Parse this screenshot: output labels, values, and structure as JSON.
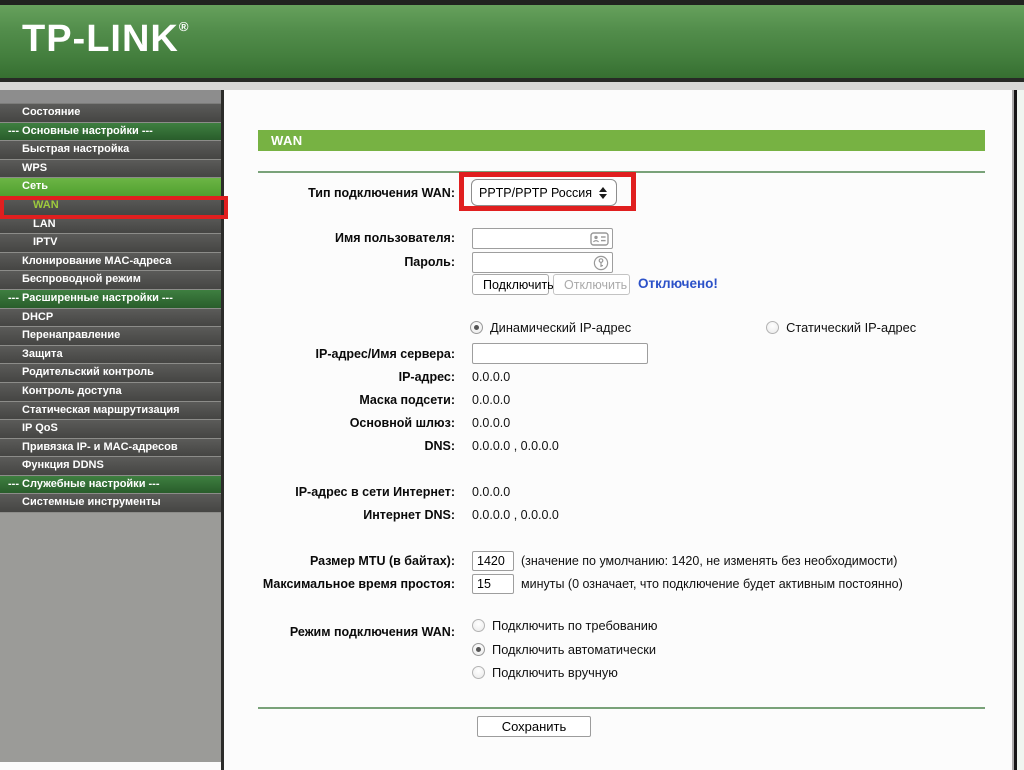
{
  "brand": {
    "name": "TP-LINK",
    "registered": "®"
  },
  "colors": {
    "header_green": "#4e8a49",
    "section_green": "#2f6b31",
    "active_green": "#5ca63b",
    "wan_bar_green": "#77b243",
    "highlight_red": "#e01f1f",
    "status_blue": "#2b51c8",
    "current_item_text": "#9dc93d"
  },
  "sidebar": {
    "items": [
      {
        "label": "Состояние",
        "type": "item"
      },
      {
        "label": "--- Основные настройки ---",
        "type": "section"
      },
      {
        "label": "Быстрая настройка",
        "type": "item"
      },
      {
        "label": "WPS",
        "type": "item"
      },
      {
        "label": "Сеть",
        "type": "active"
      },
      {
        "label": "WAN",
        "type": "sub current"
      },
      {
        "label": "LAN",
        "type": "sub"
      },
      {
        "label": "IPTV",
        "type": "sub"
      },
      {
        "label": "Клонирование MAC-адреса",
        "type": "item"
      },
      {
        "label": "Беспроводной режим",
        "type": "item"
      },
      {
        "label": "--- Расширенные настройки ---",
        "type": "section"
      },
      {
        "label": "DHCP",
        "type": "item"
      },
      {
        "label": "Перенаправление",
        "type": "item"
      },
      {
        "label": "Защита",
        "type": "item"
      },
      {
        "label": "Родительский контроль",
        "type": "item"
      },
      {
        "label": "Контроль доступа",
        "type": "item"
      },
      {
        "label": "Статическая маршрутизация",
        "type": "item"
      },
      {
        "label": "IP QoS",
        "type": "item"
      },
      {
        "label": "Привязка IP- и MAC-адресов",
        "type": "item"
      },
      {
        "label": "Функция DDNS",
        "type": "item"
      },
      {
        "label": "--- Служебные настройки ---",
        "type": "section"
      },
      {
        "label": "Системные инструменты",
        "type": "item"
      }
    ]
  },
  "main": {
    "title": "WAN",
    "connection_type": {
      "label": "Тип подключения WAN:",
      "value": "PPTP/PPTP Россия"
    },
    "username": {
      "label": "Имя пользователя:",
      "value": ""
    },
    "password": {
      "label": "Пароль:",
      "value": ""
    },
    "connect_button": "Подключить",
    "disconnect_button": "Отключить",
    "status_text": "Отключено!",
    "ip_mode": {
      "options": [
        {
          "label": "Динамический IP-адрес",
          "selected": true
        },
        {
          "label": "Статический IP-адрес",
          "selected": false
        }
      ]
    },
    "server": {
      "label": "IP-адрес/Имя сервера:",
      "value": ""
    },
    "ip": {
      "label": "IP-адрес:",
      "value": "0.0.0.0"
    },
    "mask": {
      "label": "Маска подсети:",
      "value": "0.0.0.0"
    },
    "gateway": {
      "label": "Основной шлюз:",
      "value": "0.0.0.0"
    },
    "dns": {
      "label": "DNS:",
      "value": "0.0.0.0 , 0.0.0.0"
    },
    "inet_ip": {
      "label": "IP-адрес в сети Интернет:",
      "value": "0.0.0.0"
    },
    "inet_dns": {
      "label": "Интернет DNS:",
      "value": "0.0.0.0 , 0.0.0.0"
    },
    "mtu": {
      "label": "Размер MTU (в байтах):",
      "value": "1420",
      "note": "(значение по умолчанию: 1420, не изменять без необходимости)"
    },
    "idle": {
      "label": "Максимальное время простоя:",
      "value": "15",
      "note": "минуты (0 означает, что подключение будет активным постоянно)"
    },
    "wan_mode": {
      "label": "Режим подключения WAN:",
      "options": [
        {
          "label": "Подключить по требованию",
          "selected": false
        },
        {
          "label": "Подключить автоматически",
          "selected": true
        },
        {
          "label": "Подключить вручную",
          "selected": false
        }
      ]
    },
    "save_button": "Сохранить"
  }
}
